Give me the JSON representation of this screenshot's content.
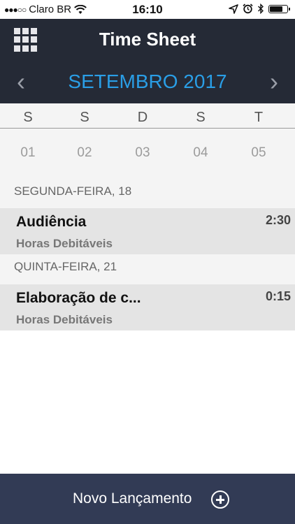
{
  "status_bar": {
    "signal_dots": "●●●○○",
    "carrier": "Claro BR",
    "time": "16:10",
    "icons": [
      "wifi-icon",
      "location-arrow-icon",
      "alarm-icon",
      "bluetooth-icon",
      "battery-icon"
    ],
    "battery_level": 0.8
  },
  "header": {
    "title": "Time Sheet",
    "menu_icon": "grid-menu-icon",
    "month": "SETEMBRO 2017",
    "prev_icon": "‹",
    "next_icon": "›"
  },
  "calendar": {
    "weekday_labels": [
      "S",
      "S",
      "D",
      "S",
      "T"
    ],
    "day_numbers": [
      "01",
      "02",
      "03",
      "04",
      "05"
    ]
  },
  "entries": {
    "sections": [
      {
        "date_label": "SEGUNDA-FEIRA, 18",
        "items": [
          {
            "title": "Audiência",
            "duration": "2:30",
            "category": "Horas Debitáveis"
          }
        ]
      },
      {
        "date_label": "QUINTA-FEIRA, 21",
        "items": [
          {
            "title": "Elaboração de c...",
            "duration": "0:15",
            "category": "Horas Debitáveis"
          }
        ]
      }
    ]
  },
  "footer": {
    "new_entry_label": "Novo Lançamento",
    "icon": "plus-circle-icon"
  },
  "colors": {
    "header_bg": "#252a36",
    "accent": "#2a9ee6",
    "footer_bg": "#323b55",
    "entry_bg": "#e4e4e4",
    "section_bg": "#f4f4f4"
  }
}
